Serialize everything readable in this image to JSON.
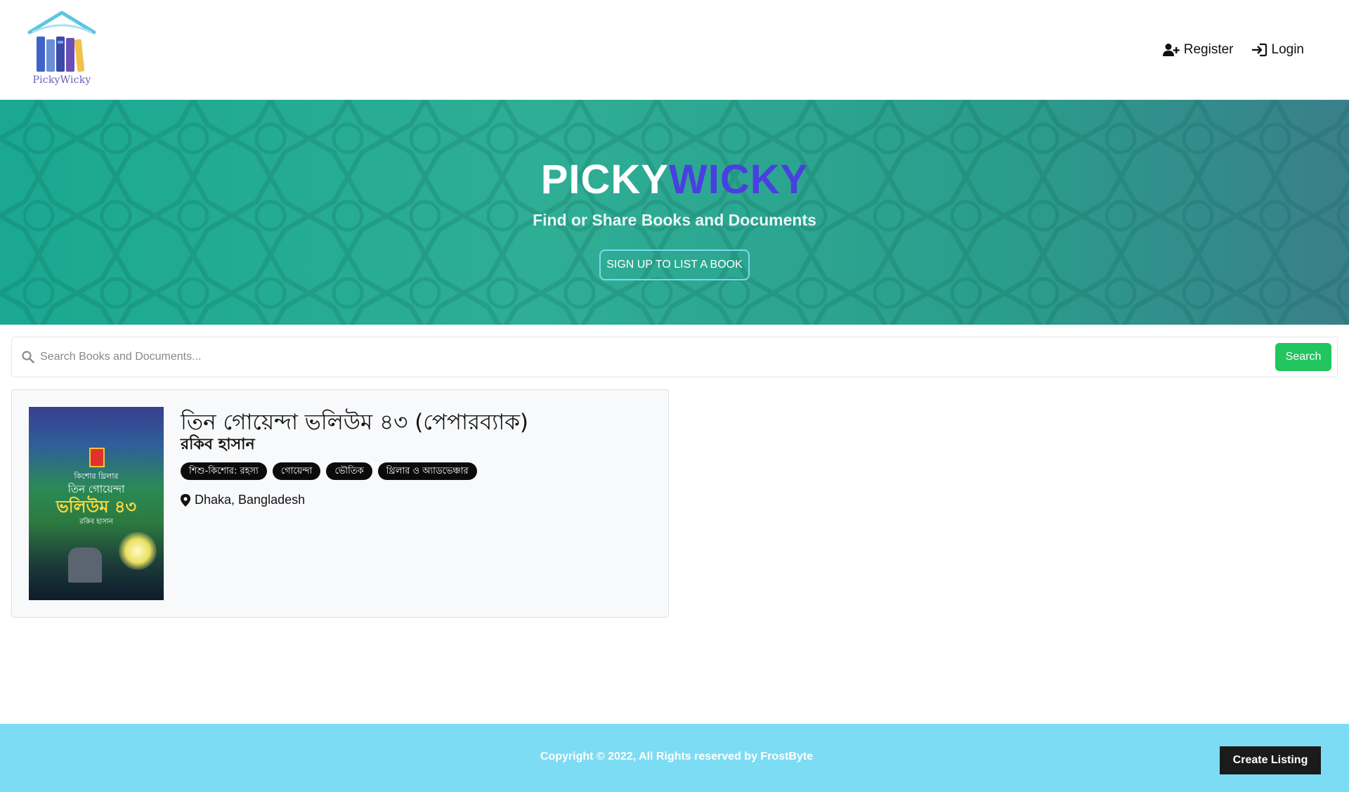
{
  "header": {
    "logo_text": "PickyWicky",
    "nav": {
      "register_label": "Register",
      "login_label": "Login"
    }
  },
  "hero": {
    "title_part1": "PICKY",
    "title_part2": "WICKY",
    "subtitle": "Find or Share Books and Documents",
    "cta_label": "SIGN UP TO LIST A BOOK"
  },
  "search": {
    "placeholder": "Search Books and Documents...",
    "value": "",
    "button_label": "Search"
  },
  "listings": [
    {
      "title": "তিন গোয়েন্দা ভলিউম ৪৩ (পেপারব্যাক)",
      "author": "রকিব হাসান",
      "tags": [
        "শিশু-কিশোর: রহস্য",
        "গোয়েন্দা",
        "ভৌতিক",
        "থ্রিলার ও অ্যাডভেঞ্চার"
      ],
      "location": "Dhaka, Bangladesh",
      "cover": {
        "series_line": "কিশোর থ্রিলার",
        "series_name": "তিন গোয়েন্দা",
        "volume_text": "ভলিউম ৪৩",
        "author_line": "রকিব হাসান"
      }
    }
  ],
  "footer": {
    "copyright": "Copyright © 2022, All Rights reserved by FrostByte",
    "create_listing_label": "Create Listing"
  },
  "colors": {
    "hero_accent": "#4a3fe0",
    "search_button": "#22c55e",
    "footer_bg": "#7cdcf4",
    "tag_bg": "#0b0b0b"
  },
  "icons": {
    "register": "user-plus-icon",
    "login": "sign-in-icon",
    "search": "search-icon",
    "location": "map-marker-icon"
  }
}
